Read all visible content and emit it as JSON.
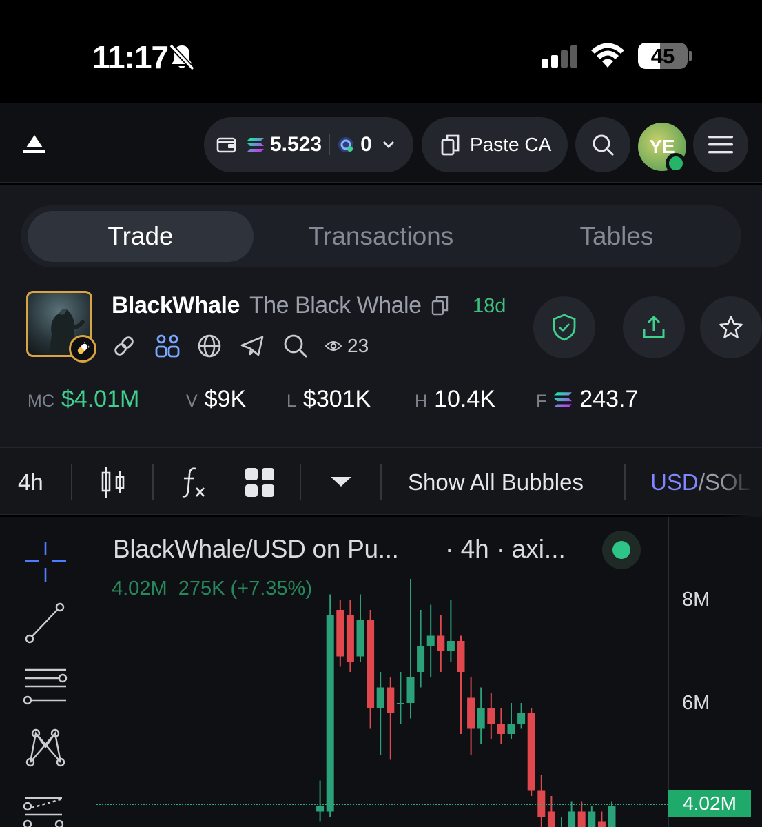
{
  "status_bar": {
    "time": "11:17",
    "battery": "45",
    "battery_level": 0.45,
    "icons": [
      "bell-muted-icon",
      "cellular-signal-icon",
      "wifi-icon",
      "battery-icon"
    ]
  },
  "topnav": {
    "wallet_sol_balance": "5.523",
    "wallet_points": "0",
    "paste_label": "Paste CA",
    "avatar_initials": "YE",
    "icons": [
      "logo-icon",
      "wallet-icon",
      "solana-icon",
      "points-icon",
      "chevron-down-icon",
      "copy-icon",
      "search-icon",
      "menu-icon"
    ]
  },
  "tabs": [
    {
      "label": "Trade",
      "active": true
    },
    {
      "label": "Transactions",
      "active": false
    },
    {
      "label": "Tables",
      "active": false
    }
  ],
  "token": {
    "symbol": "BlackWhale",
    "name": "The Black Whale",
    "age": "18d",
    "watchers": "23",
    "icons": [
      "link-icon",
      "holders-icon",
      "globe-icon",
      "telegram-icon",
      "search-icon",
      "eye-icon"
    ],
    "actions": [
      "shield-check-icon",
      "share-icon",
      "star-icon"
    ]
  },
  "stats": [
    {
      "label": "MC",
      "value": "$4.01M",
      "color": "#3fd08e"
    },
    {
      "label": "V",
      "value": "$9K"
    },
    {
      "label": "L",
      "value": "$301K"
    },
    {
      "label": "H",
      "value": "10.4K"
    },
    {
      "label": "F",
      "value": "243.7"
    }
  ],
  "toolbar": {
    "interval": "4h",
    "bubbles": "Show All Bubbles",
    "currency_usd": "USD",
    "currency_sep": "/",
    "currency_sol": "SOL",
    "icons": [
      "candles-icon",
      "indicators-icon",
      "layout-grid-icon",
      "dropdown-caret-icon"
    ]
  },
  "chart": {
    "title": "BlackWhale/USD on Pu...",
    "interval_text": "· 4h · axi...",
    "ohlc_price": "4.02M",
    "ohlc_change": "275K (+7.35%)",
    "y_labels": [
      "8M",
      "6M"
    ],
    "last_price": "4.02M",
    "colors": {
      "up": "#2aa178",
      "down": "#e0484e"
    },
    "tools": [
      "crosshair-icon",
      "trendline-icon",
      "horizontal-lines-icon",
      "pattern-icon",
      "fib-icon"
    ]
  },
  "chart_data": {
    "type": "candlestick",
    "ylabel": "",
    "yticks": [
      "8M",
      "6M"
    ],
    "last_price": 4.02,
    "unit": "M",
    "candles": [
      {
        "o": 3.6,
        "c": 3.6,
        "h": 3.6,
        "l": 3.6
      },
      {
        "o": 3.9,
        "c": 4.0,
        "h": 4.5,
        "l": 3.7
      },
      {
        "o": 3.9,
        "c": 7.7,
        "h": 8.1,
        "l": 3.8
      },
      {
        "o": 7.8,
        "c": 6.9,
        "h": 8.0,
        "l": 6.7
      },
      {
        "o": 7.7,
        "c": 6.8,
        "h": 8.0,
        "l": 6.6
      },
      {
        "o": 6.9,
        "c": 7.6,
        "h": 8.1,
        "l": 6.8
      },
      {
        "o": 7.6,
        "c": 5.9,
        "h": 7.8,
        "l": 5.5
      },
      {
        "o": 5.9,
        "c": 6.3,
        "h": 6.6,
        "l": 5.0
      },
      {
        "o": 6.3,
        "c": 5.8,
        "h": 6.5,
        "l": 4.9
      },
      {
        "o": 6.0,
        "c": 6.0,
        "h": 6.6,
        "l": 5.6
      },
      {
        "o": 6.0,
        "c": 6.5,
        "h": 8.4,
        "l": 5.7
      },
      {
        "o": 6.6,
        "c": 7.1,
        "h": 7.8,
        "l": 6.3
      },
      {
        "o": 7.1,
        "c": 7.3,
        "h": 7.9,
        "l": 6.5
      },
      {
        "o": 7.3,
        "c": 7.0,
        "h": 7.7,
        "l": 6.6
      },
      {
        "o": 7.0,
        "c": 7.2,
        "h": 8.0,
        "l": 6.8
      },
      {
        "o": 7.2,
        "c": 6.6,
        "h": 7.3,
        "l": 5.4
      },
      {
        "o": 6.1,
        "c": 5.5,
        "h": 6.5,
        "l": 5.0
      },
      {
        "o": 5.5,
        "c": 5.9,
        "h": 6.3,
        "l": 5.2
      },
      {
        "o": 5.9,
        "c": 5.6,
        "h": 6.2,
        "l": 5.3
      },
      {
        "o": 5.6,
        "c": 5.4,
        "h": 5.9,
        "l": 5.2
      },
      {
        "o": 5.4,
        "c": 5.6,
        "h": 6.0,
        "l": 5.3
      },
      {
        "o": 5.6,
        "c": 5.8,
        "h": 6.0,
        "l": 5.5
      },
      {
        "o": 5.8,
        "c": 4.3,
        "h": 5.9,
        "l": 4.2
      },
      {
        "o": 4.3,
        "c": 3.8,
        "h": 4.6,
        "l": 3.6
      },
      {
        "o": 3.9,
        "c": 3.5,
        "h": 4.2,
        "l": 3.2
      },
      {
        "o": 3.5,
        "c": 3.5,
        "h": 3.8,
        "l": 3.3
      },
      {
        "o": 3.5,
        "c": 3.9,
        "h": 4.1,
        "l": 3.4
      },
      {
        "o": 3.9,
        "c": 3.6,
        "h": 4.1,
        "l": 3.5
      },
      {
        "o": 3.6,
        "c": 3.9,
        "h": 4.0,
        "l": 3.5
      },
      {
        "o": 3.7,
        "c": 3.6,
        "h": 3.9,
        "l": 3.5
      },
      {
        "o": 3.6,
        "c": 4.0,
        "h": 4.1,
        "l": 3.5
      }
    ]
  }
}
